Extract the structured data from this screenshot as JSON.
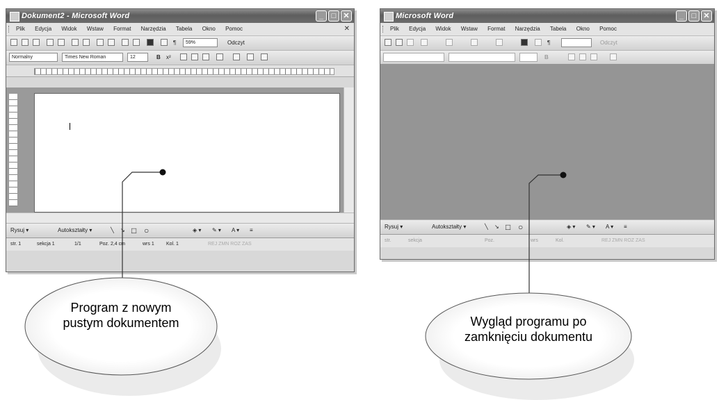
{
  "window1": {
    "title": "Dokument2 - Microsoft Word",
    "menu": [
      "Plik",
      "Edycja",
      "Widok",
      "Wstaw",
      "Format",
      "Narzędzia",
      "Tabela",
      "Okno",
      "Pomoc"
    ],
    "zoom": "59%",
    "read_button": "Odczyt",
    "style_field": "Normalny",
    "font_field": "Times New Roman",
    "size_field": "12",
    "bold_label": "B",
    "drawbar": {
      "draw": "Rysuj ▾",
      "autoshapes": "Autokształty ▾"
    },
    "status": {
      "page": "str. 1",
      "section": "sekcja 1",
      "pages": "1/1",
      "pos": "Poz. 2,4 cm",
      "line": "wrs 1",
      "col": "Kol. 1",
      "flags": "REJ  ZMN  ROZ  ZAS"
    }
  },
  "window2": {
    "title": "Microsoft Word",
    "menu": [
      "Plik",
      "Edycja",
      "Widok",
      "Wstaw",
      "Format",
      "Narzędzia",
      "Tabela",
      "Okno",
      "Pomoc"
    ],
    "read_button": "Odczyt",
    "drawbar": {
      "draw": "Rysuj ▾",
      "autoshapes": "Autokształty ▾"
    },
    "status": {
      "page": "str.",
      "section": "sekcja",
      "pos": "Poz.",
      "line": "wrs",
      "col": "Kol.",
      "flags": "REJ  ZMN  ROZ  ZAS"
    }
  },
  "callouts": {
    "left": {
      "line1": "Program z nowym",
      "line2": "pustym dokumentem"
    },
    "right": {
      "line1": "Wygląd programu po",
      "line2": "zamknięciu dokumentu"
    }
  },
  "icons": [
    "app-icon",
    "minimize-icon",
    "maximize-icon",
    "close-icon"
  ]
}
